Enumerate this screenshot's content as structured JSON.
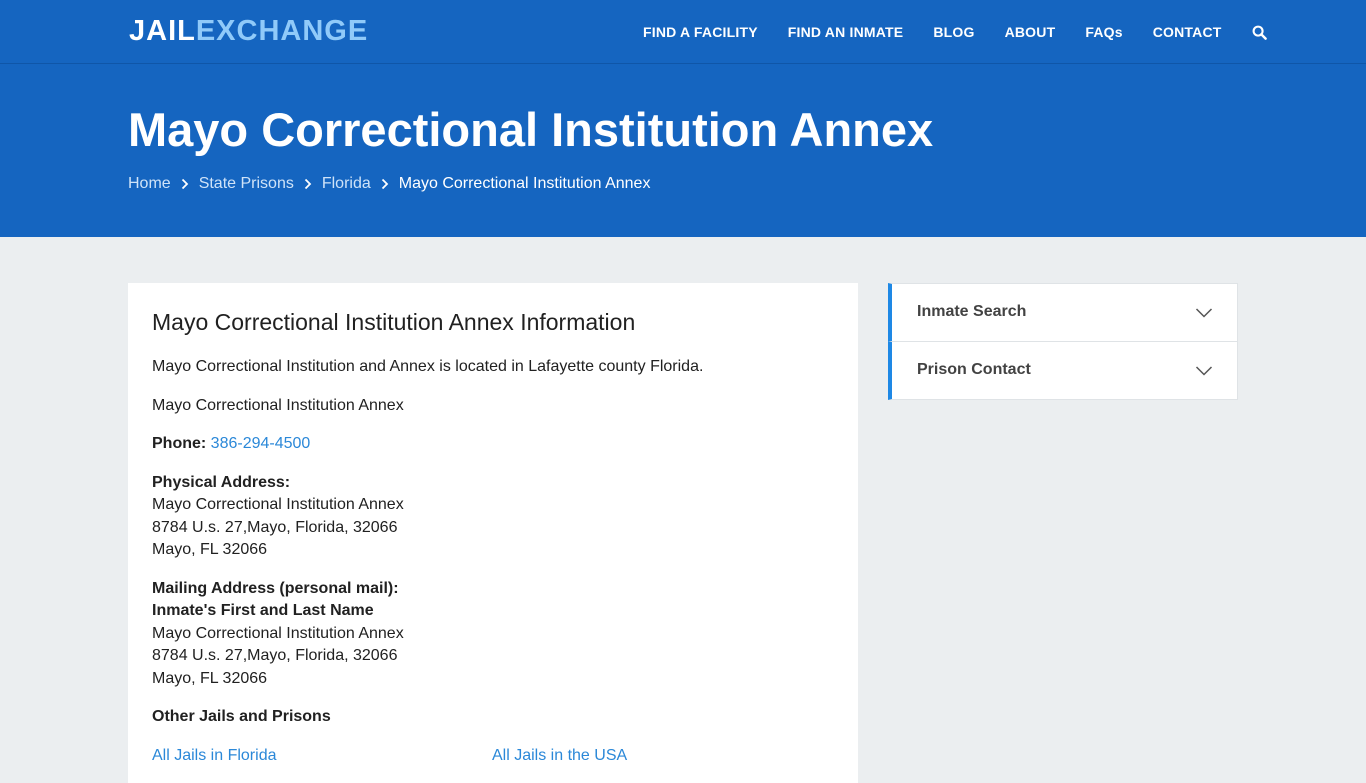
{
  "header": {
    "logo_part1": "JAIL",
    "logo_part2": "EXCHANGE",
    "nav": [
      "FIND A FACILITY",
      "FIND AN INMATE",
      "BLOG",
      "ABOUT",
      "FAQs",
      "CONTACT"
    ],
    "search_icon": "search-icon"
  },
  "hero": {
    "title": "Mayo Correctional Institution Annex",
    "breadcrumbs": [
      "Home",
      "State Prisons",
      "Florida",
      "Mayo Correctional Institution Annex"
    ]
  },
  "main": {
    "heading": "Mayo Correctional Institution Annex Information",
    "intro": "Mayo Correctional Institution and Annex is located in Lafayette county Florida.",
    "facility_name": "Mayo Correctional Institution Annex",
    "phone_label": "Phone:",
    "phone": "386-294-4500",
    "physical_label": "Physical Address:",
    "physical_lines": [
      "Mayo Correctional Institution Annex",
      "8784 U.s. 27,Mayo, Florida, 32066",
      "Mayo, FL 32066"
    ],
    "mailing_label": "Mailing Address (personal mail):",
    "mailing_name": "Inmate's First and Last Name",
    "mailing_lines": [
      "Mayo Correctional Institution Annex",
      "8784 U.s. 27,Mayo, Florida, 32066",
      "Mayo, FL 32066"
    ],
    "other_heading": "Other Jails and Prisons",
    "links": [
      "All Jails in Florida",
      "All Jails in the USA"
    ]
  },
  "sidebar": {
    "accordions": [
      "Inmate Search",
      "Prison Contact"
    ]
  },
  "colors": {
    "brand_blue": "#1565c0",
    "logo_accent": "#90caf9",
    "link": "#2b88d8",
    "accordion_accent": "#1e88e5"
  }
}
